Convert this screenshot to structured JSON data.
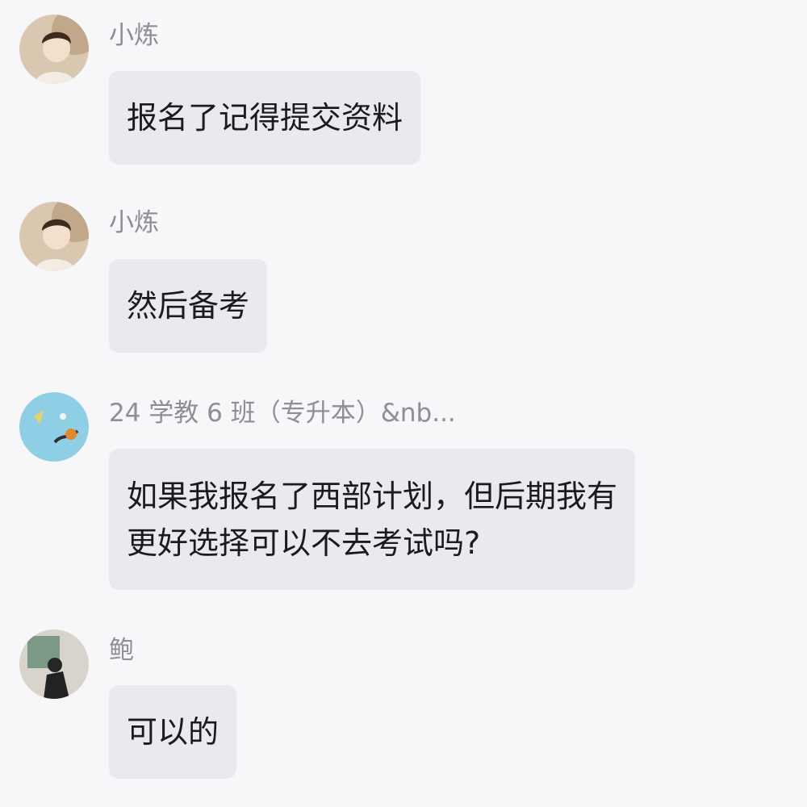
{
  "messages": [
    {
      "sender": "小炼",
      "avatar_icon": "user-avatar-icon",
      "text": "报名了记得提交资料"
    },
    {
      "sender": "小炼",
      "avatar_icon": "user-avatar-icon",
      "text": "然后备考"
    },
    {
      "sender": "24 学教 6 班（专升本）&nb...",
      "avatar_icon": "group-avatar-icon",
      "text": "如果我报名了西部计划，但后期我有\n更好选择可以不去考试吗?"
    },
    {
      "sender": "鲍",
      "avatar_icon": "user-avatar-icon",
      "text": "可以的"
    }
  ],
  "colors": {
    "background": "#f7f7f9",
    "bubble": "#eaeaee",
    "sender_text": "#8e8e93",
    "message_text": "#1b1b1d"
  }
}
